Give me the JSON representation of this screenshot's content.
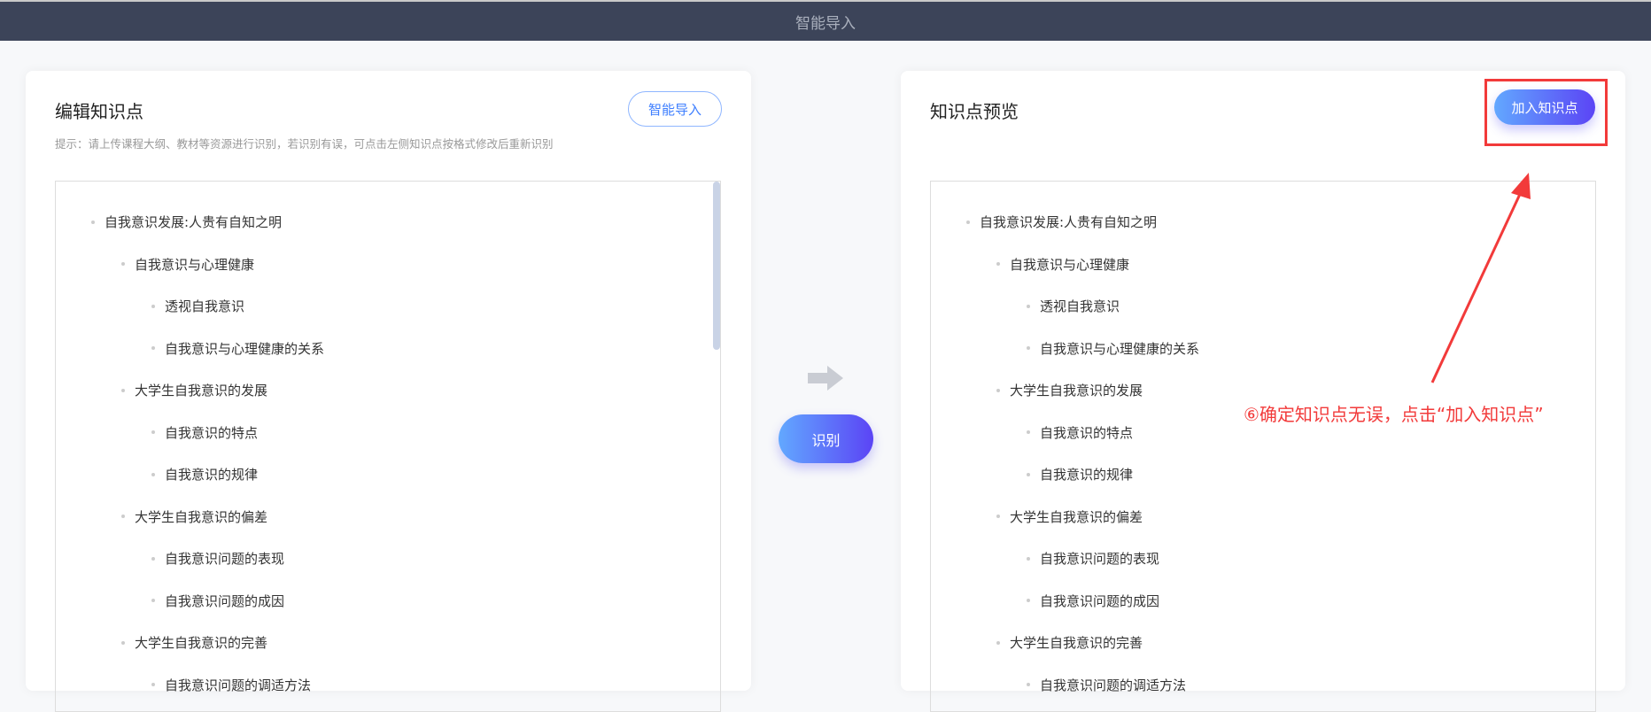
{
  "header": {
    "title": "智能导入"
  },
  "left": {
    "title": "编辑知识点",
    "hint": "提示：请上传课程大纲、教材等资源进行识别，若识别有误，可点击左侧知识点按格式修改后重新识别",
    "import_button": "智能导入"
  },
  "middle": {
    "recognize_button": "识别"
  },
  "right": {
    "title": "知识点预览",
    "add_button": "加入知识点"
  },
  "annotation": {
    "text": "⑥确定知识点无误，点击“加入知识点”",
    "color": "#f23a3a"
  },
  "tree": [
    {
      "level": 0,
      "label": "自我意识发展:人贵有自知之明"
    },
    {
      "level": 1,
      "label": "自我意识与心理健康"
    },
    {
      "level": 2,
      "label": "透视自我意识"
    },
    {
      "level": 2,
      "label": "自我意识与心理健康的关系"
    },
    {
      "level": 1,
      "label": "大学生自我意识的发展"
    },
    {
      "level": 2,
      "label": "自我意识的特点"
    },
    {
      "level": 2,
      "label": "自我意识的规律"
    },
    {
      "level": 1,
      "label": "大学生自我意识的偏差"
    },
    {
      "level": 2,
      "label": "自我意识问题的表现"
    },
    {
      "level": 2,
      "label": "自我意识问题的成因"
    },
    {
      "level": 1,
      "label": "大学生自我意识的完善"
    },
    {
      "level": 2,
      "label": "自我意识问题的调适方法"
    }
  ]
}
